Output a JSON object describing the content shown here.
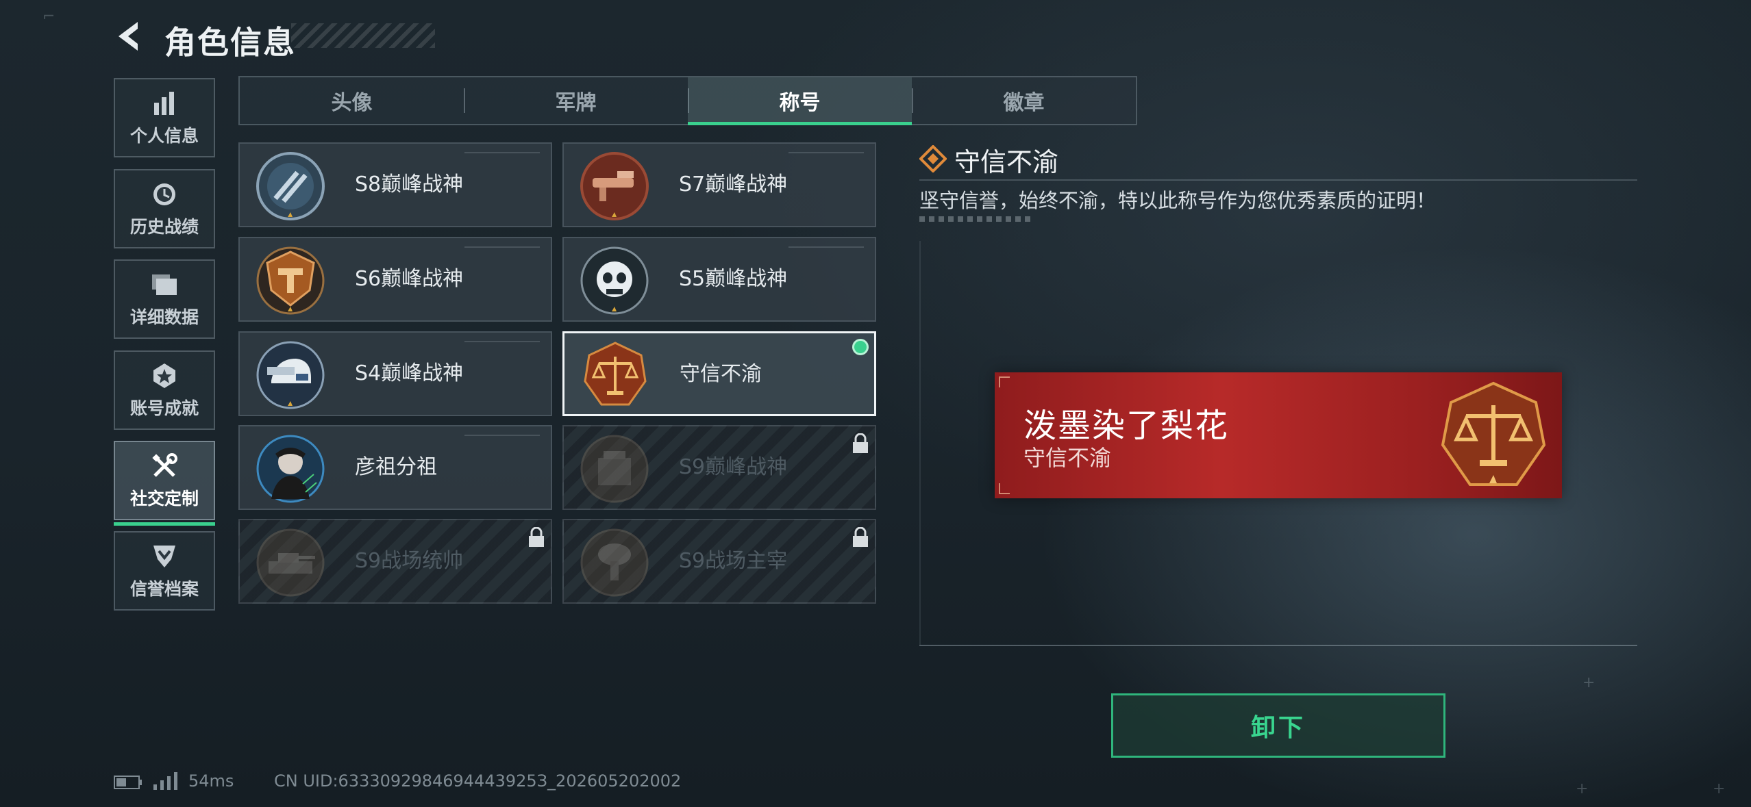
{
  "header": {
    "title": "角色信息"
  },
  "sidebar": {
    "items": [
      {
        "label": "个人信息",
        "icon": "bar-chart-icon"
      },
      {
        "label": "历史战绩",
        "icon": "history-icon"
      },
      {
        "label": "详细数据",
        "icon": "folder-icon"
      },
      {
        "label": "账号成就",
        "icon": "achievement-icon"
      },
      {
        "label": "社交定制",
        "icon": "tools-icon",
        "active": true
      },
      {
        "label": "信誉档案",
        "icon": "shield-icon"
      }
    ]
  },
  "tabs": [
    {
      "label": "头像"
    },
    {
      "label": "军牌"
    },
    {
      "label": "称号",
      "active": true
    },
    {
      "label": "徽章"
    }
  ],
  "titles": [
    {
      "name": "S8巅峰战神",
      "locked": false
    },
    {
      "name": "S7巅峰战神",
      "locked": false
    },
    {
      "name": "S6巅峰战神",
      "locked": false
    },
    {
      "name": "S5巅峰战神",
      "locked": false
    },
    {
      "name": "S4巅峰战神",
      "locked": false
    },
    {
      "name": "守信不渝",
      "locked": false,
      "selected": true
    },
    {
      "name": "彦祖分祖",
      "locked": false
    },
    {
      "name": "S9巅峰战神",
      "locked": true
    },
    {
      "name": "S9战场统帅",
      "locked": true
    },
    {
      "name": "S9战场主宰",
      "locked": true
    }
  ],
  "detail": {
    "title": "守信不渝",
    "description": "坚守信誉，始终不渝，特以此称号作为您优秀素质的证明！"
  },
  "preview": {
    "player_name": "泼墨染了梨花",
    "title": "守信不渝"
  },
  "actions": {
    "unequip_label": "卸下"
  },
  "status": {
    "ping": "54ms",
    "uid": "CN UID:6333092984694443925З_202605202002"
  },
  "colors": {
    "accent": "#3ad08e",
    "banner_red": "#b72a29"
  }
}
